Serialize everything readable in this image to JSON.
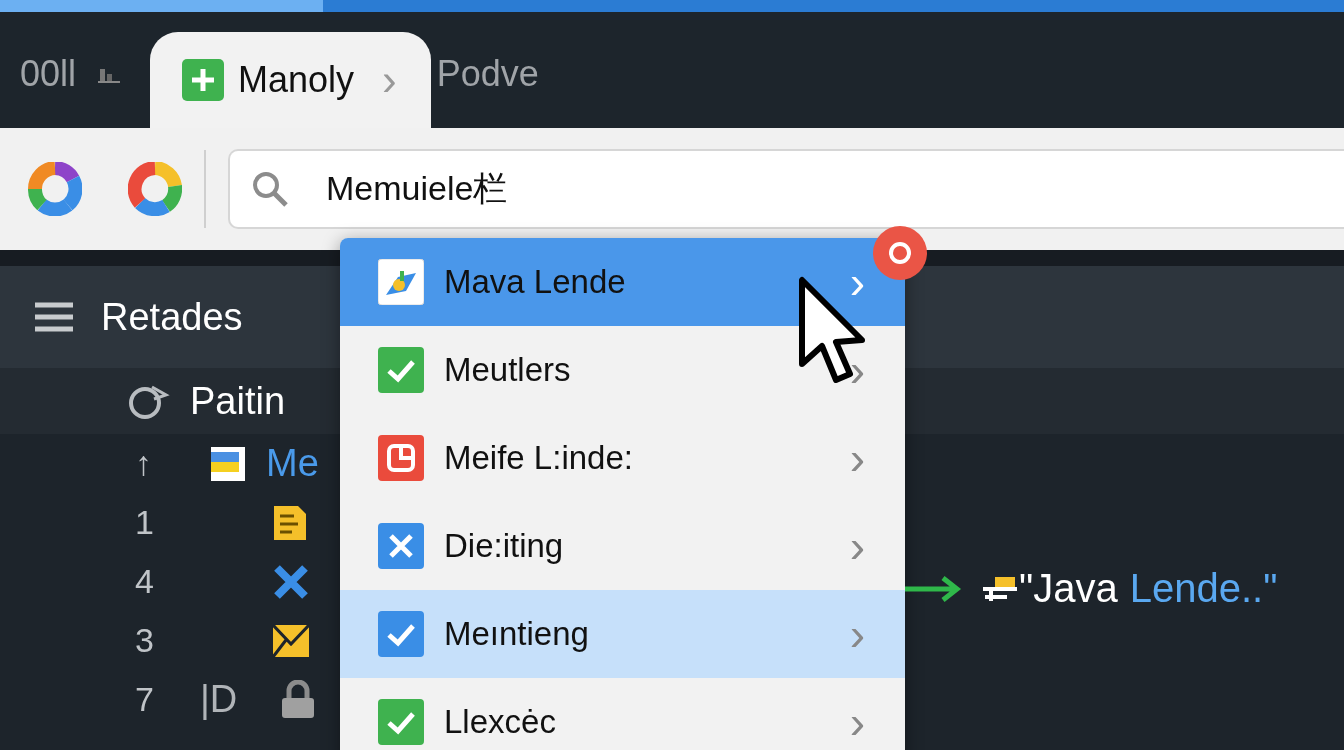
{
  "progress": {
    "level": 0.24
  },
  "tabs": [
    {
      "label": "00ll",
      "kind": "bars",
      "selected": false
    },
    {
      "label": "Manoly",
      "kind": "plus",
      "chevron": "›",
      "selected": true
    },
    {
      "label": "Podve",
      "selected": false
    }
  ],
  "toolbar": {
    "buttons": [
      {
        "kind": "ring-a"
      },
      {
        "kind": "ring-b"
      }
    ]
  },
  "search": {
    "value": "Memuiele栏"
  },
  "panel": {
    "title": "Retades"
  },
  "tree": [
    {
      "kind": "circle",
      "label": "Paitin",
      "children": [
        {
          "marker": "↑",
          "kind": "doc-stripes",
          "label": "Me",
          "children": [
            {
              "marker": "1",
              "kind": "note"
            },
            {
              "marker": "4",
              "kind": "cross"
            },
            {
              "marker": "3",
              "kind": "envelope"
            },
            {
              "marker": "7",
              "prefix": "|D",
              "kind": "lock"
            }
          ]
        }
      ]
    }
  ],
  "menu": {
    "items": [
      {
        "label": "Mava Lende",
        "kind": "app",
        "color": "#ffffff",
        "chevron": "›",
        "selected": true,
        "highlighted": false
      },
      {
        "label": "Meutlers",
        "kind": "check",
        "color": "#3fb24f",
        "chevron": "›",
        "selected": false,
        "highlighted": false
      },
      {
        "label": "Meife L:inde:",
        "kind": "note",
        "color": "#ea4b3c",
        "chevron": "›",
        "selected": false,
        "highlighted": false
      },
      {
        "label": "Die:iting",
        "kind": "cross",
        "color": "#3a8ee6",
        "chevron": "›",
        "selected": false,
        "highlighted": false
      },
      {
        "label": "Meıntieng",
        "kind": "check",
        "color": "#3a8ee6",
        "chevron": "›",
        "selected": false,
        "highlighted": true
      },
      {
        "label": "Llexcėc",
        "kind": "check",
        "color": "#3fb24f",
        "chevron": "›",
        "selected": false,
        "highlighted": false
      }
    ],
    "badge": {
      "kind": "ring"
    }
  },
  "annotation": {
    "lead": "\"Java",
    "tail": "Lende..\""
  }
}
